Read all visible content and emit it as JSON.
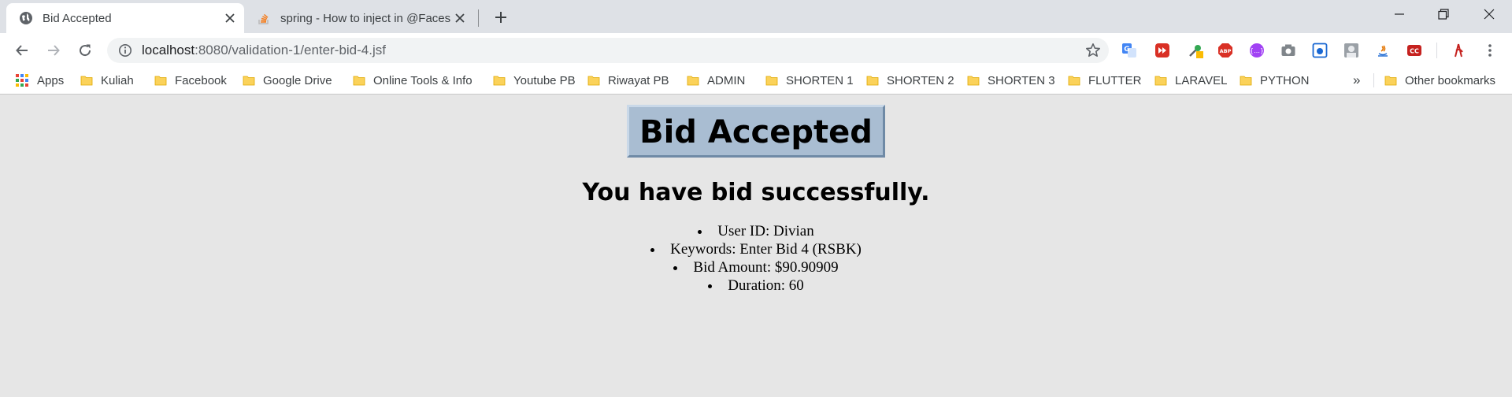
{
  "browser": {
    "tabs": [
      {
        "title": "Bid Accepted",
        "active": true
      },
      {
        "title": "spring - How to inject in @FacesV",
        "active": false
      }
    ],
    "address": {
      "host": "localhost",
      "path": ":8080/validation-1/enter-bid-4.jsf"
    },
    "bookmarks": {
      "apps": "Apps",
      "items": [
        "Kuliah",
        "Facebook",
        "Google Drive",
        "Online Tools & Info",
        "Youtube PB",
        "Riwayat PB",
        "ADMIN",
        "SHORTEN 1",
        "SHORTEN 2",
        "SHORTEN 3",
        "FLUTTER",
        "LARAVEL",
        "PYTHON"
      ],
      "overflow": "»",
      "other": "Other bookmarks"
    },
    "extensions": {
      "abp_label": "ABP",
      "cc_label": "CC"
    }
  },
  "page": {
    "heading": "Bid Accepted",
    "message": "You have bid successfully.",
    "details": [
      "User ID: Divian",
      "Keywords: Enter Bid 4 (RSBK)",
      "Bid Amount: $90.90909",
      "Duration: 60"
    ]
  },
  "colors": {
    "page_background": "#e6e6e6",
    "heading_box": "#a9bdd2",
    "tabstrip": "#dee1e6",
    "folder": "#fbd25a"
  }
}
